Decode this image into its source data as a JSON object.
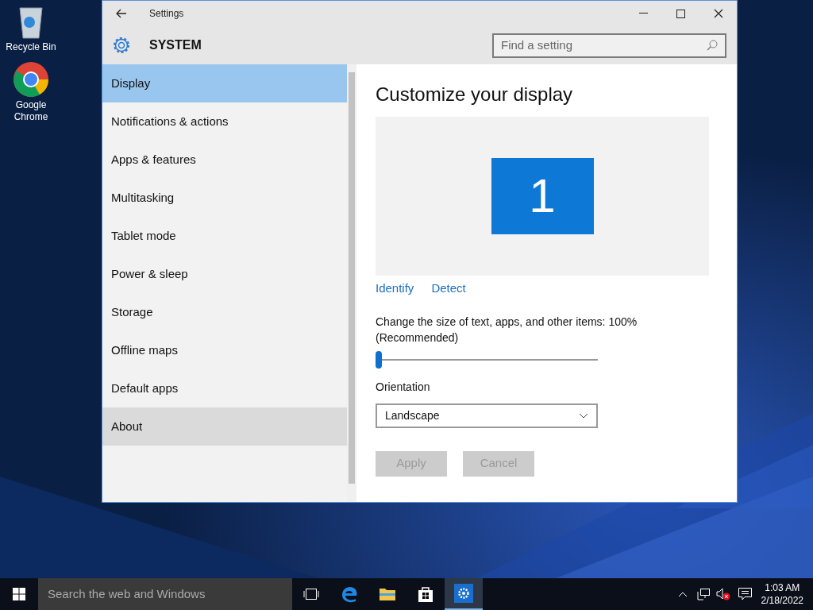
{
  "desktop_icons": [
    {
      "kind": "recycle",
      "label": "Recycle Bin"
    },
    {
      "kind": "chrome",
      "label": "Google Chrome"
    }
  ],
  "window": {
    "title": "Settings",
    "section": "SYSTEM",
    "search": {
      "placeholder": "Find a setting"
    }
  },
  "sidebar": {
    "items": [
      {
        "label": "Display",
        "selected": true,
        "hovered": false
      },
      {
        "label": "Notifications & actions",
        "selected": false,
        "hovered": false
      },
      {
        "label": "Apps & features",
        "selected": false,
        "hovered": false
      },
      {
        "label": "Multitasking",
        "selected": false,
        "hovered": false
      },
      {
        "label": "Tablet mode",
        "selected": false,
        "hovered": false
      },
      {
        "label": "Power & sleep",
        "selected": false,
        "hovered": false
      },
      {
        "label": "Storage",
        "selected": false,
        "hovered": false
      },
      {
        "label": "Offline maps",
        "selected": false,
        "hovered": false
      },
      {
        "label": "Default apps",
        "selected": false,
        "hovered": false
      },
      {
        "label": "About",
        "selected": false,
        "hovered": true
      }
    ]
  },
  "content": {
    "heading": "Customize your display",
    "monitor": "1",
    "links": [
      "Identify",
      "Detect"
    ],
    "scale": {
      "label": "Change the size of text, apps, and other items: 100% (Recommended)",
      "level": 0
    },
    "orientation": {
      "label": "Orientation",
      "value": "Landscape"
    },
    "buttons": [
      {
        "label": "Apply",
        "disabled": true
      },
      {
        "label": "Cancel",
        "disabled": true
      }
    ]
  },
  "taskbar": {
    "search": {
      "placeholder": "Search the web and Windows"
    },
    "apps": [
      {
        "kind": "taskview",
        "selected": false
      },
      {
        "kind": "edge",
        "selected": false
      },
      {
        "kind": "folder",
        "selected": false
      },
      {
        "kind": "store",
        "selected": false
      },
      {
        "kind": "settings",
        "selected": true
      }
    ],
    "time": "1:03 AM",
    "date": "2/18/2022"
  }
}
